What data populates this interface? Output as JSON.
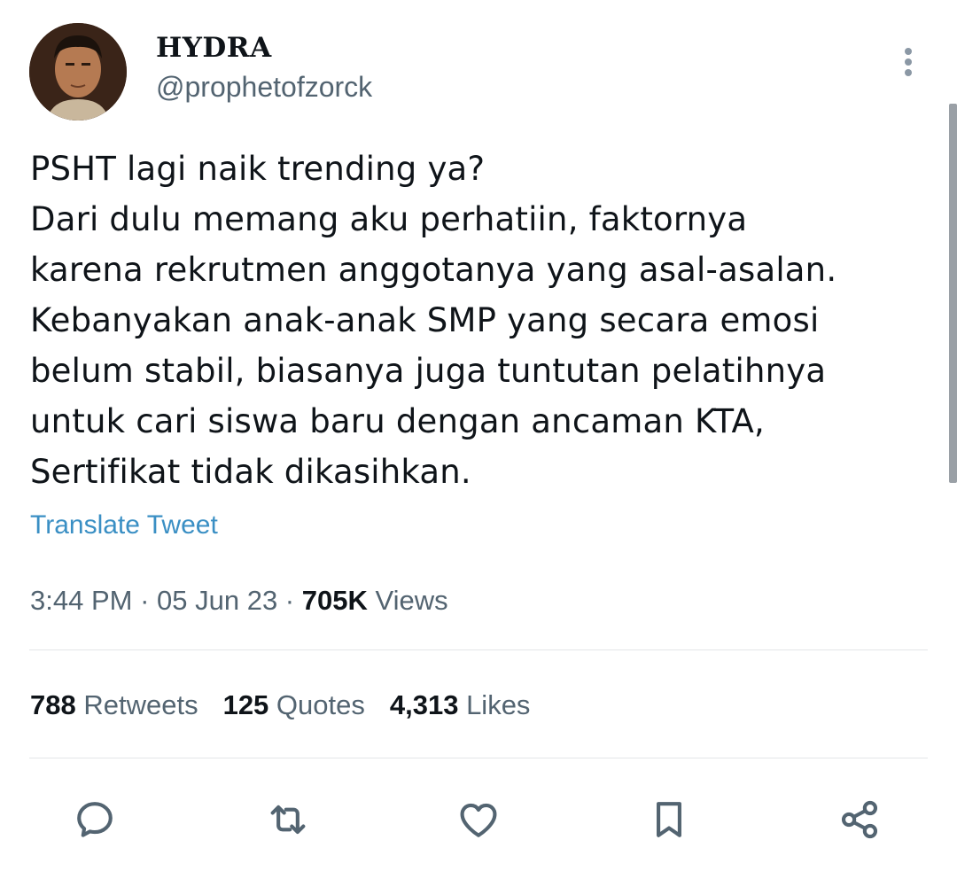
{
  "author": {
    "display_name": "HYDRA",
    "handle": "@prophetofzorck"
  },
  "tweet": {
    "lines": [
      "PSHT lagi naik trending ya?",
      "Dari dulu memang aku perhatiin, faktornya",
      "karena rekrutmen anggotanya yang asal-asalan.",
      "Kebanyakan anak-anak SMP yang secara emosi",
      "belum stabil, biasanya juga tuntutan pelatihnya",
      "untuk cari siswa baru dengan ancaman KTA,",
      "Sertifikat tidak dikasihkan."
    ],
    "translate_label": "Translate Tweet"
  },
  "meta": {
    "time": "3:44 PM",
    "separator": " · ",
    "date": "05 Jun 23",
    "views_count": "705K",
    "views_label": " Views"
  },
  "stats": {
    "retweets_count": "788",
    "retweets_label": " Retweets",
    "quotes_count": "125",
    "quotes_label": " Quotes",
    "likes_count": "4,313",
    "likes_label": " Likes"
  },
  "actions": [
    "reply-icon",
    "retweet-icon",
    "like-icon",
    "bookmark-icon",
    "share-icon"
  ],
  "colors": {
    "link": "#3a8fc4",
    "secondary_text": "#536471",
    "icon": "#536471"
  }
}
